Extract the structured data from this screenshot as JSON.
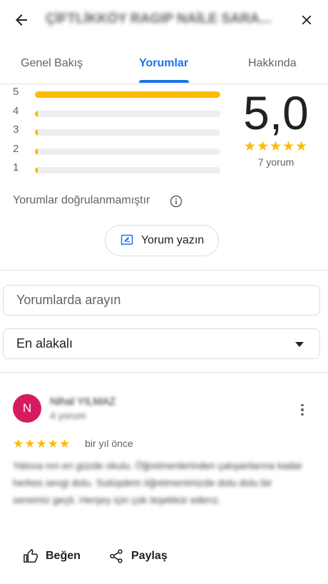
{
  "header": {
    "title": "ÇİFTLİKKÖY RAGIP NAİLE SARA...",
    "back_icon": "arrow-back-icon",
    "close_icon": "close-icon"
  },
  "tabs": [
    {
      "label": "Genel Bakış",
      "active": false
    },
    {
      "label": "Yorumlar",
      "active": true
    },
    {
      "label": "Hakkında",
      "active": false
    }
  ],
  "summary": {
    "rating": "5,0",
    "stars": "★★★★★",
    "count_text": "7 yorum",
    "distribution": [
      {
        "label": "5",
        "fraction": 1.0
      },
      {
        "label": "4",
        "fraction": 0.0
      },
      {
        "label": "3",
        "fraction": 0.0
      },
      {
        "label": "2",
        "fraction": 0.0
      },
      {
        "label": "1",
        "fraction": 0.0
      }
    ],
    "star_color": "#fbbc04"
  },
  "not_verified_text": "Yorumlar doğrulanmamıştır",
  "write_review_label": "Yorum yazın",
  "search": {
    "placeholder": "Yorumlarda arayın",
    "value": ""
  },
  "sort": {
    "selected": "En alakalı"
  },
  "review": {
    "avatar_letter": "N",
    "avatar_color": "#d81b60",
    "name": "Nihal YILMAZ",
    "meta": "4 yorum",
    "stars": "★★★★★",
    "time": "bir yıl önce",
    "text": "Yalova nın en güzde okulu. Öğretmenlerinden çalışanlarına kadar herkes sevgi dolu. Sutüşdem öğretmenimizde dolu dolu bir senemiz geçti. Herşey için çok teşekkür ederız.",
    "like_label": "Beğen",
    "share_label": "Paylaş"
  },
  "colors": {
    "accent": "#1a73e8",
    "star": "#fbbc04"
  }
}
